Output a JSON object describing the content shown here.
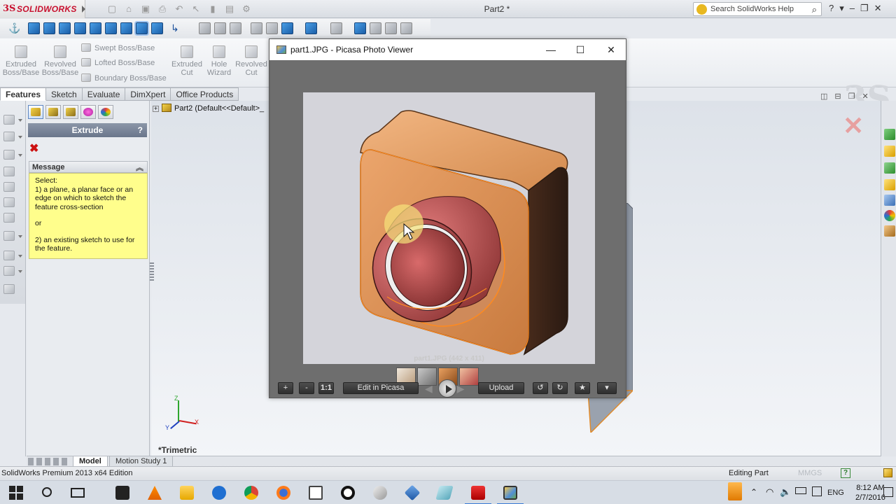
{
  "solidworks": {
    "brand_logo": "SOLIDWORKS",
    "brand_mark": "3S",
    "document_title": "Part2 *",
    "search_placeholder": "Search SolidWorks Help",
    "help_glyph": "?",
    "command_manager": {
      "large_buttons": [
        {
          "id": "extruded-boss",
          "label": "Extruded Boss/Base",
          "line1": "Extruded",
          "line2": "Boss/Base"
        },
        {
          "id": "revolved-boss",
          "label": "Revolved Boss/Base",
          "line1": "Revolved",
          "line2": "Boss/Base"
        },
        {
          "id": "extruded-cut",
          "label": "Extruded Cut",
          "line1": "Extruded",
          "line2": "Cut"
        },
        {
          "id": "hole-wizard",
          "label": "Hole Wizard",
          "line1": "Hole",
          "line2": "Wizard"
        },
        {
          "id": "revolved-cut",
          "label": "Revolved Cut",
          "line1": "Revolved",
          "line2": "Cut"
        }
      ],
      "small_buttons": [
        "Swept Boss/Base",
        "Lofted Boss/Base",
        "Boundary Boss/Base"
      ]
    },
    "tabs": [
      {
        "label": "Features",
        "active": true
      },
      {
        "label": "Sketch",
        "active": false
      },
      {
        "label": "Evaluate",
        "active": false
      },
      {
        "label": "DimXpert",
        "active": false
      },
      {
        "label": "Office Products",
        "active": false
      }
    ],
    "property_manager": {
      "title": "Extrude",
      "help": "?",
      "cancel_glyph": "✖",
      "message_heading": "Message",
      "message_lines": [
        "Select:",
        "1) a plane, a planar face or an edge on which to sketch the feature cross-section",
        "or",
        "2) an existing sketch to use for the feature."
      ]
    },
    "feature_tree_root": "Part2  (Default<<Default>_",
    "view_orientation": "*Trimetric",
    "triad_labels": {
      "x": "X",
      "y": "Y",
      "z": "Z"
    },
    "bottom_tabs": [
      {
        "label": "Model",
        "active": true
      },
      {
        "label": "Motion Study 1",
        "active": false
      }
    ],
    "status": {
      "edition": "SolidWorks Premium 2013 x64 Edition",
      "mode": "Editing Part",
      "units": "MMGS",
      "help_glyph": "?"
    }
  },
  "picasa": {
    "window_title": "part1.JPG - Picasa Photo Viewer",
    "minimize": "—",
    "maximize": "☐",
    "close": "✕",
    "image_caption": "part1.JPG (442 x 411)",
    "controls": {
      "zoom_in": "+",
      "zoom_out": "-",
      "actual_size": "1:1",
      "edit": "Edit in Picasa",
      "upload": "Upload",
      "rotate_left": "↺",
      "rotate_right": "↻",
      "star": "★",
      "more": "▾"
    },
    "colors": {
      "part_body": "#e79a5e",
      "part_edge": "#b8642a",
      "boss_inner": "#c85c5c"
    }
  },
  "taskbar": {
    "language": "ENG",
    "time": "8:12 AM",
    "date": "2/7/2016",
    "apps": [
      "start",
      "search",
      "task-view",
      "store",
      "vlc",
      "file-explorer",
      "edge",
      "chrome",
      "firefox",
      "notepad",
      "opera",
      "snagit",
      "virtualbox",
      "notes",
      "solidworks",
      "picasa"
    ]
  }
}
